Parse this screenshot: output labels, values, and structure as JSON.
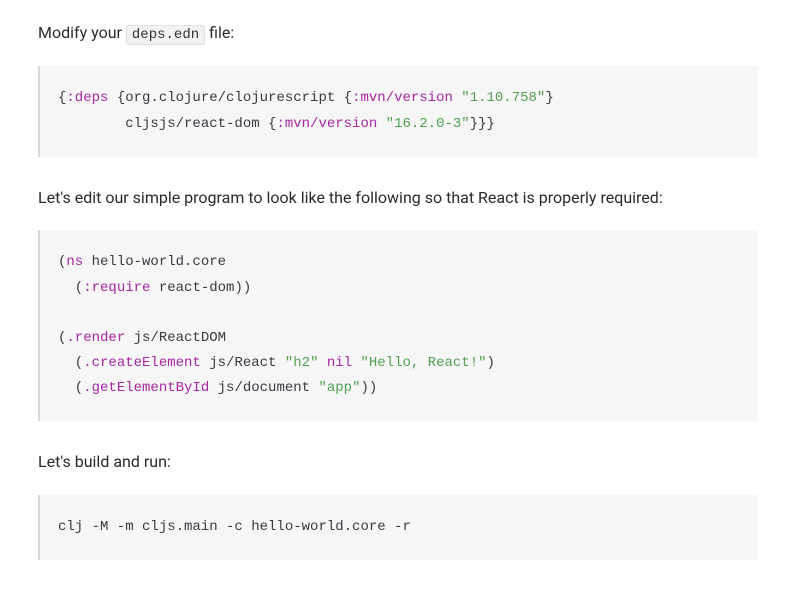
{
  "para1": {
    "pre": "Modify your ",
    "code": "deps.edn",
    "post": " file:"
  },
  "block1": {
    "l1a": "{",
    "l1b": ":deps",
    "l1c": " {org.clojure/clojurescript {",
    "l1d": ":mvn/version",
    "l1e": " ",
    "l1f": "\"1.10.758\"",
    "l1g": "}",
    "l2a": "        cljsjs/react-dom {",
    "l2b": ":mvn/version",
    "l2c": " ",
    "l2d": "\"16.2.0-3\"",
    "l2e": "}}}"
  },
  "para2": "Let's edit our simple program to look like the following so that React is properly required:",
  "block2": {
    "l1a": "(",
    "l1b": "ns",
    "l1c": " hello-world.core",
    "l2a": "  (",
    "l2b": ":require",
    "l2c": " react-dom))",
    "l3a": "(",
    "l3b": ".render",
    "l3c": " js/ReactDOM",
    "l4a": "  (",
    "l4b": ".createElement",
    "l4c": " js/React ",
    "l4d": "\"h2\"",
    "l4e": " ",
    "l4f": "nil",
    "l4g": " ",
    "l4h": "\"Hello, React!\"",
    "l4i": ")",
    "l5a": "  (",
    "l5b": ".getElementById",
    "l5c": " js/document ",
    "l5d": "\"app\"",
    "l5e": "))"
  },
  "para3": "Let's build and run:",
  "block3": {
    "l1": "clj -M -m cljs.main -c hello-world.core -r"
  }
}
